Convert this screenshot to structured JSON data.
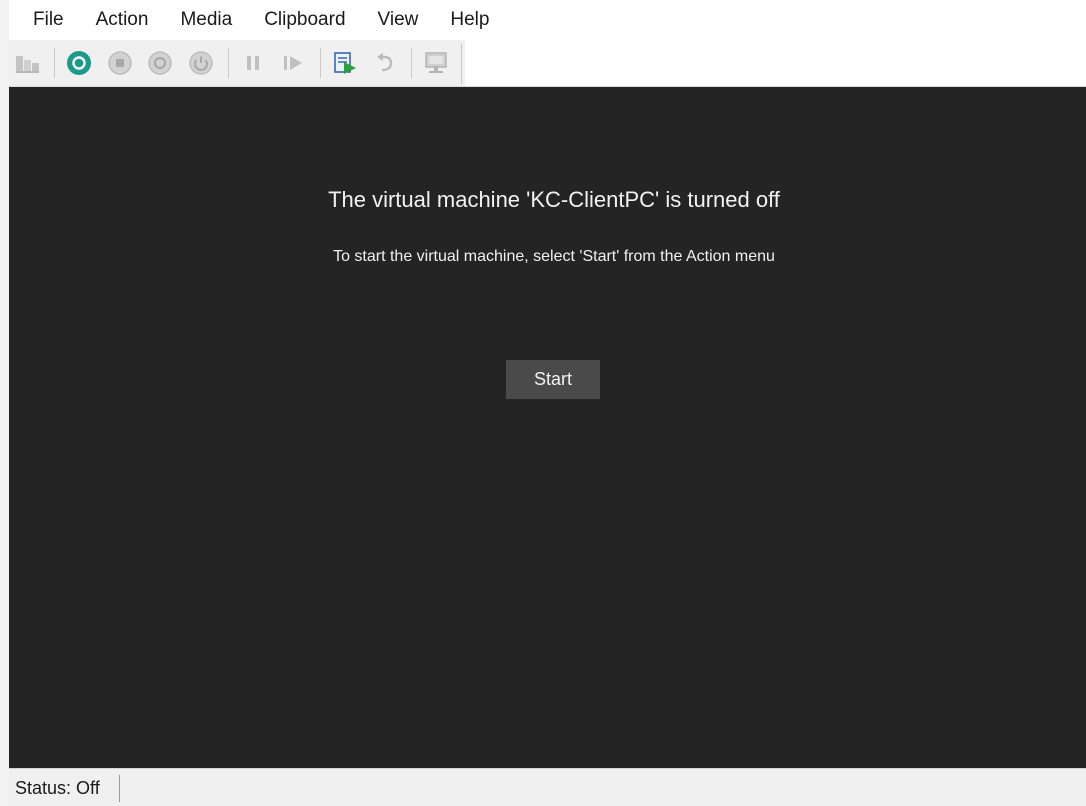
{
  "menu": {
    "items": [
      "File",
      "Action",
      "Media",
      "Clipboard",
      "View",
      "Help"
    ]
  },
  "toolbar": {
    "buttons": [
      {
        "icon": "ctrl-alt-del-icon",
        "state": "disabled"
      },
      {
        "icon": "start-icon",
        "state": "enabled",
        "color": "#1a9a8a"
      },
      {
        "icon": "turn-off-icon",
        "state": "disabled"
      },
      {
        "icon": "shut-down-icon",
        "state": "disabled"
      },
      {
        "icon": "save-icon",
        "state": "disabled"
      },
      {
        "icon": "pause-icon",
        "state": "disabled"
      },
      {
        "icon": "resume-icon",
        "state": "disabled"
      },
      {
        "icon": "checkpoint-icon",
        "state": "enabled"
      },
      {
        "icon": "revert-icon",
        "state": "disabled"
      },
      {
        "icon": "enhanced-session-icon",
        "state": "disabled"
      }
    ]
  },
  "vm": {
    "title": "The virtual machine 'KC-ClientPC' is turned off",
    "subtitle": "To start the virtual machine, select 'Start' from the Action menu",
    "start_label": "Start"
  },
  "status": {
    "text": "Status: Off"
  },
  "colors": {
    "display_bg": "#242424",
    "start_accent": "#1a9a8a",
    "disabled_icon": "#c4c4c4"
  }
}
